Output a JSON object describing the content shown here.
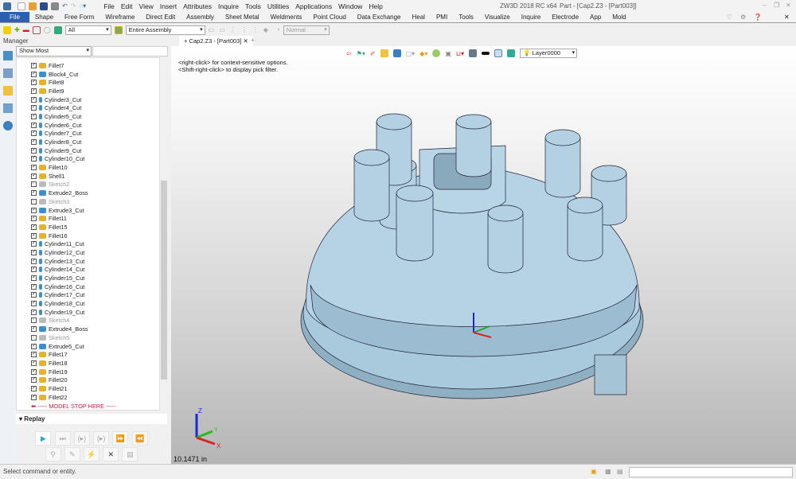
{
  "titlebar": {
    "menus": [
      "File",
      "Edit",
      "View",
      "Insert",
      "Attributes",
      "Inquire",
      "Tools",
      "Utilities",
      "Applications",
      "Window",
      "Help"
    ],
    "app": "ZW3D 2018 RC x64",
    "doc": "Part - [Cap2.Z3 - [Part003]]"
  },
  "ribbon": {
    "tabs": [
      "File",
      "Shape",
      "Free Form",
      "Wireframe",
      "Direct Edit",
      "Assembly",
      "Sheet Metal",
      "Weldments",
      "Point Cloud",
      "Data Exchange",
      "Heal",
      "PMI",
      "Tools",
      "Visualize",
      "Inquire",
      "Electrode",
      "App",
      "Mold"
    ]
  },
  "toolbar": {
    "filter": "All",
    "scope": "Entire Assembly",
    "display": "Normal"
  },
  "manager": {
    "title": "Manager",
    "show": "Show Most",
    "items": [
      {
        "label": "Fillet7",
        "type": "fillet"
      },
      {
        "label": "Block4_Cut",
        "type": "block"
      },
      {
        "label": "Fillet8",
        "type": "fillet"
      },
      {
        "label": "Fillet9",
        "type": "fillet"
      },
      {
        "label": "Cylinder3_Cut",
        "type": "cyl"
      },
      {
        "label": "Cylinder4_Cut",
        "type": "cyl"
      },
      {
        "label": "Cylinder5_Cut",
        "type": "cyl"
      },
      {
        "label": "Cylinder6_Cut",
        "type": "cyl"
      },
      {
        "label": "Cylinder7_Cut",
        "type": "cyl"
      },
      {
        "label": "Cylinder8_Cut",
        "type": "cyl"
      },
      {
        "label": "Cylinder9_Cut",
        "type": "cyl"
      },
      {
        "label": "Cylinder10_Cut",
        "type": "cyl"
      },
      {
        "label": "Fillet10",
        "type": "fillet"
      },
      {
        "label": "Shell1",
        "type": "fillet"
      },
      {
        "label": "Sketch2",
        "type": "sketch"
      },
      {
        "label": "Extrude2_Boss",
        "type": "block"
      },
      {
        "label": "Sketch3",
        "type": "sketch"
      },
      {
        "label": "Extrude3_Cut",
        "type": "block"
      },
      {
        "label": "Fillet11",
        "type": "fillet"
      },
      {
        "label": "Fillet15",
        "type": "fillet"
      },
      {
        "label": "Fillet16",
        "type": "fillet"
      },
      {
        "label": "Cylinder11_Cut",
        "type": "cyl"
      },
      {
        "label": "Cylinder12_Cut",
        "type": "cyl"
      },
      {
        "label": "Cylinder13_Cut",
        "type": "cyl"
      },
      {
        "label": "Cylinder14_Cut",
        "type": "cyl"
      },
      {
        "label": "Cylinder15_Cut",
        "type": "cyl"
      },
      {
        "label": "Cylinder16_Cut",
        "type": "cyl"
      },
      {
        "label": "Cylinder17_Cut",
        "type": "cyl"
      },
      {
        "label": "Cylinder18_Cut",
        "type": "cyl"
      },
      {
        "label": "Cylinder19_Cut",
        "type": "cyl"
      },
      {
        "label": "Sketch4",
        "type": "sketch"
      },
      {
        "label": "Extrude4_Boss",
        "type": "block"
      },
      {
        "label": "Sketch5",
        "type": "sketch"
      },
      {
        "label": "Extrude5_Cut",
        "type": "block"
      },
      {
        "label": "Fillet17",
        "type": "fillet"
      },
      {
        "label": "Fillet18",
        "type": "fillet"
      },
      {
        "label": "Fillet19",
        "type": "fillet"
      },
      {
        "label": "Fillet20",
        "type": "fillet"
      },
      {
        "label": "Fillet21",
        "type": "fillet"
      },
      {
        "label": "Fillet22",
        "type": "fillet"
      }
    ],
    "stop": "----- MODEL STOP HERE -----"
  },
  "replay": {
    "title": "Replay"
  },
  "doc_tab": "Cap2.Z3 - [Part003]",
  "viewport": {
    "hint1": "<right-click> for context-sensitive options.",
    "hint2": "<Shift-right-click> to display pick filter.",
    "layer": "Layer0000",
    "scale": "10.1471 in"
  },
  "status": "Select command or entity.",
  "colors": {
    "accent": "#2b5fb4",
    "model": "#a8c8dc"
  }
}
